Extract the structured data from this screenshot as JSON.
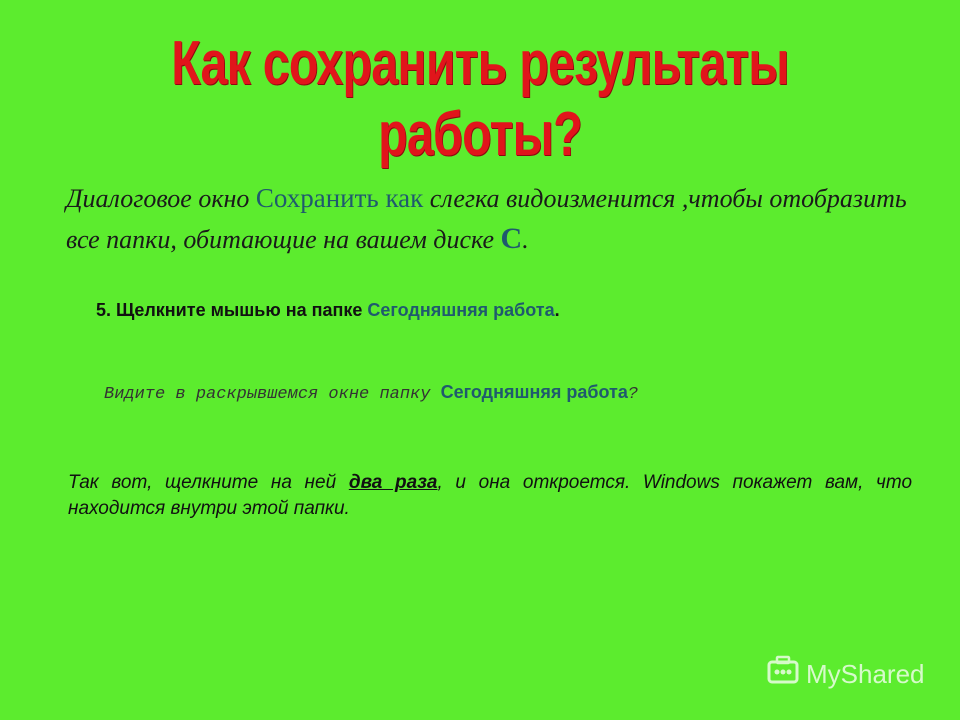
{
  "slide": {
    "title": "Как сохранить результаты работы?",
    "paragraph1": {
      "part1": "Диалоговое окно",
      "dialog_name": "Сохранить как",
      "part2": "слегка видоизменится ,чтобы отобразить все папки, обитающие на вашем диске",
      "drive": "С",
      "end": "."
    },
    "step": {
      "prefix": "5. Щелкните мышью на папке",
      "folder": "Сегодняшняя работа",
      "end": "."
    },
    "question": {
      "prefix": "Видите в раскрывшемся окне папку",
      "folder": "Сегодняшняя работа",
      "end": "?"
    },
    "paragraph3": {
      "part1": "Так вот, щелкните на ней",
      "highlight": "два раза",
      "part2": ", и она откроется. Windows  покажет вам, что находится внутри этой папки."
    }
  },
  "watermark": {
    "text": "MyShared",
    "icon": "myshared-logo-icon"
  },
  "colors": {
    "background": "#5cec2e",
    "title": "#e1151b",
    "accent": "#1f5a6e"
  }
}
